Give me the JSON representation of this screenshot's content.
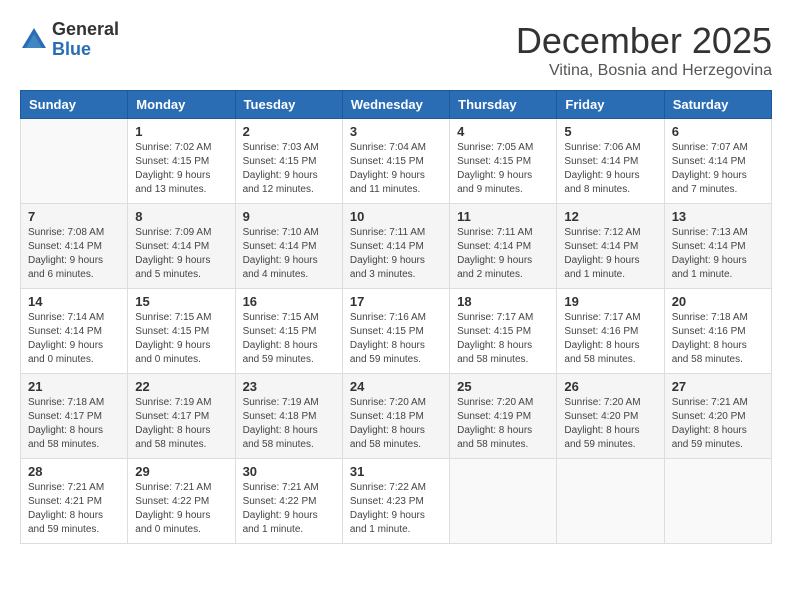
{
  "logo": {
    "general": "General",
    "blue": "Blue"
  },
  "header": {
    "month": "December 2025",
    "subtitle": "Vitina, Bosnia and Herzegovina"
  },
  "weekdays": [
    "Sunday",
    "Monday",
    "Tuesday",
    "Wednesday",
    "Thursday",
    "Friday",
    "Saturday"
  ],
  "weeks": [
    [
      {
        "day": "",
        "info": ""
      },
      {
        "day": "1",
        "info": "Sunrise: 7:02 AM\nSunset: 4:15 PM\nDaylight: 9 hours\nand 13 minutes."
      },
      {
        "day": "2",
        "info": "Sunrise: 7:03 AM\nSunset: 4:15 PM\nDaylight: 9 hours\nand 12 minutes."
      },
      {
        "day": "3",
        "info": "Sunrise: 7:04 AM\nSunset: 4:15 PM\nDaylight: 9 hours\nand 11 minutes."
      },
      {
        "day": "4",
        "info": "Sunrise: 7:05 AM\nSunset: 4:15 PM\nDaylight: 9 hours\nand 9 minutes."
      },
      {
        "day": "5",
        "info": "Sunrise: 7:06 AM\nSunset: 4:14 PM\nDaylight: 9 hours\nand 8 minutes."
      },
      {
        "day": "6",
        "info": "Sunrise: 7:07 AM\nSunset: 4:14 PM\nDaylight: 9 hours\nand 7 minutes."
      }
    ],
    [
      {
        "day": "7",
        "info": "Sunrise: 7:08 AM\nSunset: 4:14 PM\nDaylight: 9 hours\nand 6 minutes."
      },
      {
        "day": "8",
        "info": "Sunrise: 7:09 AM\nSunset: 4:14 PM\nDaylight: 9 hours\nand 5 minutes."
      },
      {
        "day": "9",
        "info": "Sunrise: 7:10 AM\nSunset: 4:14 PM\nDaylight: 9 hours\nand 4 minutes."
      },
      {
        "day": "10",
        "info": "Sunrise: 7:11 AM\nSunset: 4:14 PM\nDaylight: 9 hours\nand 3 minutes."
      },
      {
        "day": "11",
        "info": "Sunrise: 7:11 AM\nSunset: 4:14 PM\nDaylight: 9 hours\nand 2 minutes."
      },
      {
        "day": "12",
        "info": "Sunrise: 7:12 AM\nSunset: 4:14 PM\nDaylight: 9 hours\nand 1 minute."
      },
      {
        "day": "13",
        "info": "Sunrise: 7:13 AM\nSunset: 4:14 PM\nDaylight: 9 hours\nand 1 minute."
      }
    ],
    [
      {
        "day": "14",
        "info": "Sunrise: 7:14 AM\nSunset: 4:14 PM\nDaylight: 9 hours\nand 0 minutes."
      },
      {
        "day": "15",
        "info": "Sunrise: 7:15 AM\nSunset: 4:15 PM\nDaylight: 9 hours\nand 0 minutes."
      },
      {
        "day": "16",
        "info": "Sunrise: 7:15 AM\nSunset: 4:15 PM\nDaylight: 8 hours\nand 59 minutes."
      },
      {
        "day": "17",
        "info": "Sunrise: 7:16 AM\nSunset: 4:15 PM\nDaylight: 8 hours\nand 59 minutes."
      },
      {
        "day": "18",
        "info": "Sunrise: 7:17 AM\nSunset: 4:15 PM\nDaylight: 8 hours\nand 58 minutes."
      },
      {
        "day": "19",
        "info": "Sunrise: 7:17 AM\nSunset: 4:16 PM\nDaylight: 8 hours\nand 58 minutes."
      },
      {
        "day": "20",
        "info": "Sunrise: 7:18 AM\nSunset: 4:16 PM\nDaylight: 8 hours\nand 58 minutes."
      }
    ],
    [
      {
        "day": "21",
        "info": "Sunrise: 7:18 AM\nSunset: 4:17 PM\nDaylight: 8 hours\nand 58 minutes."
      },
      {
        "day": "22",
        "info": "Sunrise: 7:19 AM\nSunset: 4:17 PM\nDaylight: 8 hours\nand 58 minutes."
      },
      {
        "day": "23",
        "info": "Sunrise: 7:19 AM\nSunset: 4:18 PM\nDaylight: 8 hours\nand 58 minutes."
      },
      {
        "day": "24",
        "info": "Sunrise: 7:20 AM\nSunset: 4:18 PM\nDaylight: 8 hours\nand 58 minutes."
      },
      {
        "day": "25",
        "info": "Sunrise: 7:20 AM\nSunset: 4:19 PM\nDaylight: 8 hours\nand 58 minutes."
      },
      {
        "day": "26",
        "info": "Sunrise: 7:20 AM\nSunset: 4:20 PM\nDaylight: 8 hours\nand 59 minutes."
      },
      {
        "day": "27",
        "info": "Sunrise: 7:21 AM\nSunset: 4:20 PM\nDaylight: 8 hours\nand 59 minutes."
      }
    ],
    [
      {
        "day": "28",
        "info": "Sunrise: 7:21 AM\nSunset: 4:21 PM\nDaylight: 8 hours\nand 59 minutes."
      },
      {
        "day": "29",
        "info": "Sunrise: 7:21 AM\nSunset: 4:22 PM\nDaylight: 9 hours\nand 0 minutes."
      },
      {
        "day": "30",
        "info": "Sunrise: 7:21 AM\nSunset: 4:22 PM\nDaylight: 9 hours\nand 1 minute."
      },
      {
        "day": "31",
        "info": "Sunrise: 7:22 AM\nSunset: 4:23 PM\nDaylight: 9 hours\nand 1 minute."
      },
      {
        "day": "",
        "info": ""
      },
      {
        "day": "",
        "info": ""
      },
      {
        "day": "",
        "info": ""
      }
    ]
  ]
}
